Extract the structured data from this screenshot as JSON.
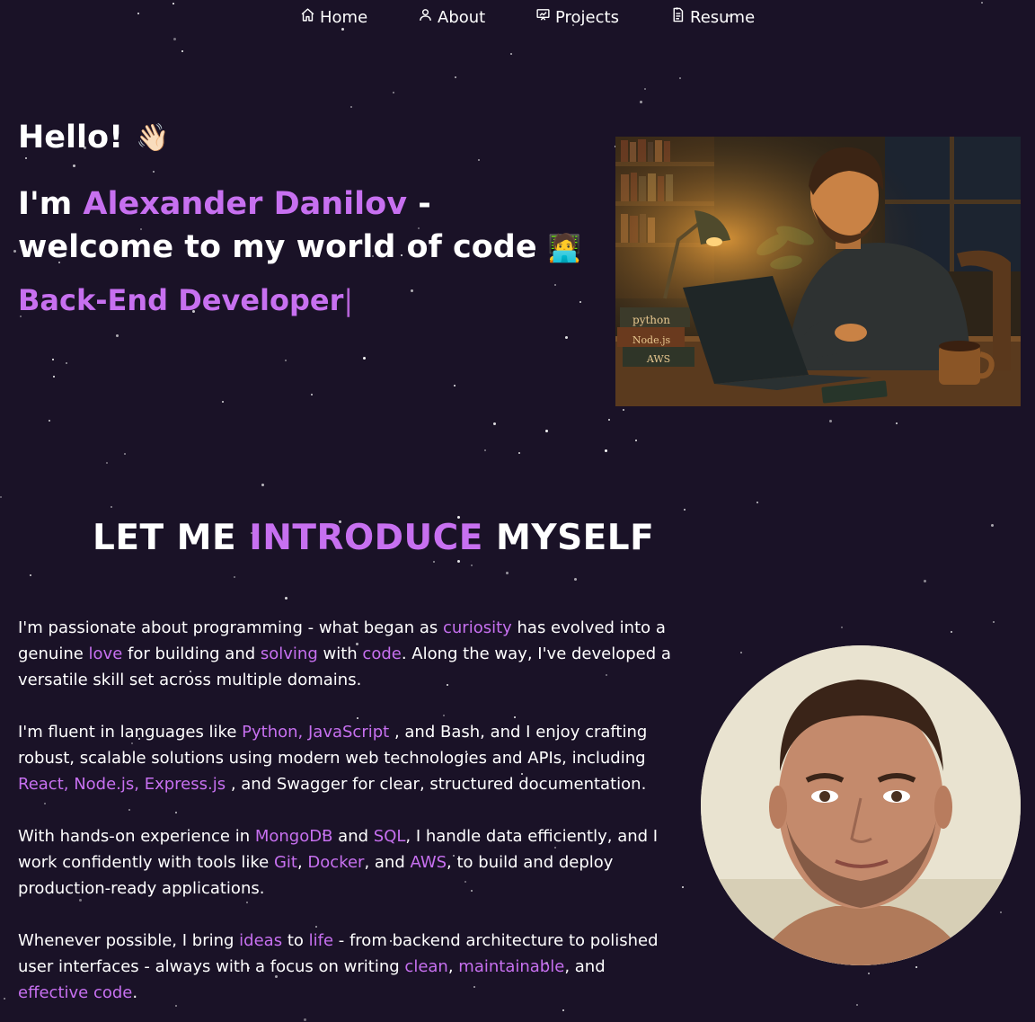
{
  "nav": {
    "items": [
      {
        "label": "Home",
        "icon": "home-icon"
      },
      {
        "label": "About",
        "icon": "user-icon"
      },
      {
        "label": "Projects",
        "icon": "presentation-icon"
      },
      {
        "label": "Resume",
        "icon": "document-icon"
      }
    ]
  },
  "hero": {
    "greeting": "Hello!",
    "greeting_emoji": "👋🏻",
    "intro_prefix": "I'm ",
    "name": "Alexander Danilov",
    "intro_suffix": " - welcome to my world of code",
    "intro_emoji": "🧑‍💻",
    "role": "Back-End Developer",
    "cursor": "|",
    "illustration_book_labels": [
      "python",
      "Node.js",
      "AWS"
    ]
  },
  "about": {
    "title_part1": "LET ME ",
    "title_accent": "INTRODUCE",
    "title_part2": " MYSELF",
    "paragraphs": [
      [
        {
          "t": "I'm passionate about programming - what began as "
        },
        {
          "t": "curiosity",
          "hl": true
        },
        {
          "t": " has evolved into a genuine "
        },
        {
          "t": "love",
          "hl": true
        },
        {
          "t": " for building and "
        },
        {
          "t": "solving",
          "hl": true
        },
        {
          "t": " with "
        },
        {
          "t": "code",
          "hl": true
        },
        {
          "t": ". Along the way, I've developed a versatile skill set across multiple domains."
        }
      ],
      [
        {
          "t": "I'm fluent in languages like "
        },
        {
          "t": "Python, JavaScript",
          "hl": true
        },
        {
          "t": " , and Bash, and I enjoy crafting robust, scalable solutions using modern web technologies and APIs, including "
        },
        {
          "t": "React, Node.js, Express.js",
          "hl": true
        },
        {
          "t": " , and Swagger for clear, structured documentation."
        }
      ],
      [
        {
          "t": "With hands-on experience in "
        },
        {
          "t": "MongoDB",
          "hl": true
        },
        {
          "t": " and "
        },
        {
          "t": "SQL",
          "hl": true
        },
        {
          "t": ", I handle data efficiently, and I work confidently with tools like "
        },
        {
          "t": "Git",
          "hl": true
        },
        {
          "t": ", "
        },
        {
          "t": "Docker",
          "hl": true
        },
        {
          "t": ", and "
        },
        {
          "t": "AWS",
          "hl": true
        },
        {
          "t": ", to build and deploy production-ready applications."
        }
      ],
      [
        {
          "t": "Whenever possible, I bring "
        },
        {
          "t": "ideas",
          "hl": true
        },
        {
          "t": " to "
        },
        {
          "t": "life",
          "hl": true
        },
        {
          "t": " - from backend architecture to polished user interfaces - always with a focus on writing "
        },
        {
          "t": "clean",
          "hl": true
        },
        {
          "t": ", "
        },
        {
          "t": "maintainable",
          "hl": true
        },
        {
          "t": ", and "
        },
        {
          "t": "effective",
          "hl": true
        },
        {
          "t": " "
        },
        {
          "t": "code",
          "hl": true
        },
        {
          "t": "."
        }
      ]
    ]
  },
  "colors": {
    "background": "#1a1227",
    "accent": "#c770f0",
    "text": "#ffffff"
  }
}
